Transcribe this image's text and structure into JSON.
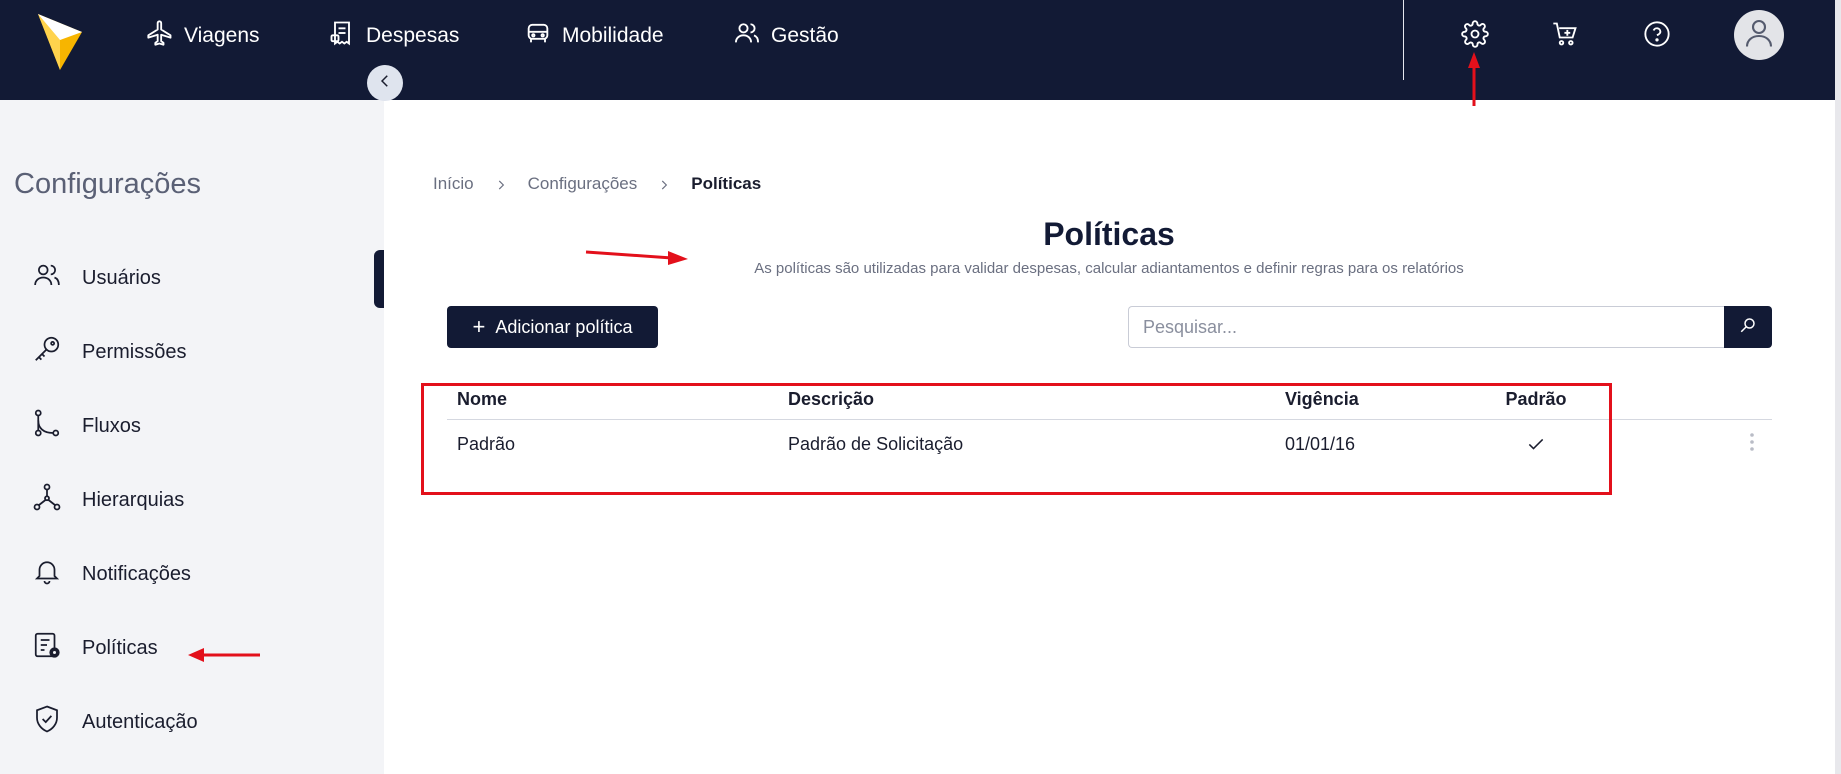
{
  "topnav": {
    "items": [
      {
        "label": "Viagens",
        "icon": "airplane-icon"
      },
      {
        "label": "Despesas",
        "icon": "receipt-icon"
      },
      {
        "label": "Mobilidade",
        "icon": "car-icon"
      },
      {
        "label": "Gestão",
        "icon": "users-icon"
      }
    ],
    "tools": [
      "gear-icon",
      "cart-plus-icon",
      "help-icon"
    ],
    "avatar_icon": "user-avatar-icon"
  },
  "sidebar": {
    "title": "Configurações",
    "items": [
      {
        "label": "Usuários",
        "icon": "users-icon"
      },
      {
        "label": "Permissões",
        "icon": "key-icon"
      },
      {
        "label": "Fluxos",
        "icon": "flow-icon"
      },
      {
        "label": "Hierarquias",
        "icon": "hierarchy-icon"
      },
      {
        "label": "Notificações",
        "icon": "bell-icon"
      },
      {
        "label": "Políticas",
        "icon": "policy-icon"
      },
      {
        "label": "Autenticação",
        "icon": "shield-check-icon"
      }
    ]
  },
  "breadcrumb": {
    "items": [
      "Início",
      "Configurações",
      "Políticas"
    ]
  },
  "page": {
    "title": "Políticas",
    "subtitle": "As políticas são utilizadas para validar despesas, calcular adiantamentos e definir regras para os relatórios",
    "add_button": "Adicionar política",
    "search_placeholder": "Pesquisar..."
  },
  "table": {
    "columns": [
      "Nome",
      "Descrição",
      "Vigência",
      "Padrão"
    ],
    "rows": [
      {
        "nome": "Padrão",
        "descricao": "Padrão de Solicitação",
        "vigencia": "01/01/16",
        "padrao": true
      }
    ]
  },
  "colors": {
    "navy": "#121a35",
    "sidebar_bg": "#f3f4f7",
    "annotation_red": "#e3101b",
    "logo_yellow": "#f7b500"
  }
}
